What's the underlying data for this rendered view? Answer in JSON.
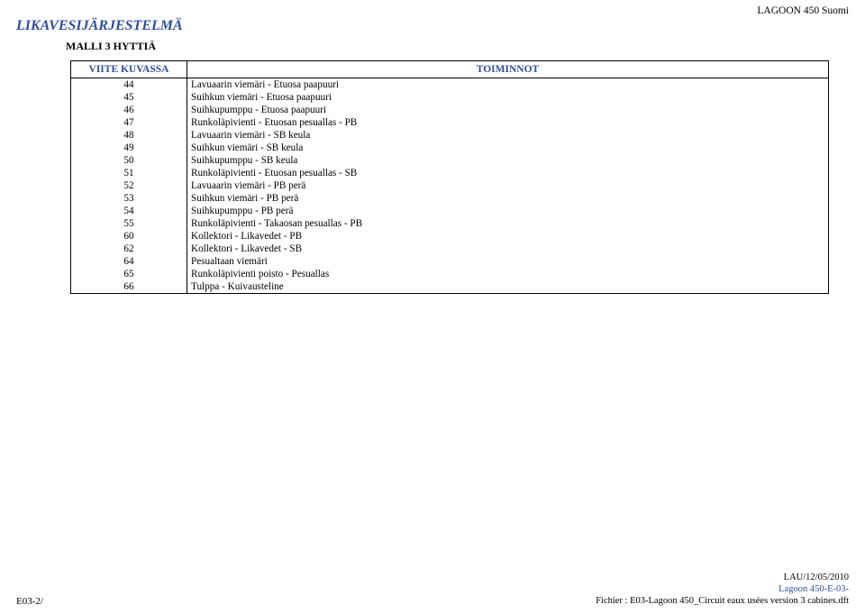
{
  "header": {
    "top_right": "LAGOON 450 Suomi",
    "title": "LIKAVESIJÄRJESTELMÄ",
    "subtitle": "MALLI 3 HYTTIÄ"
  },
  "table": {
    "col_ref": "VIITE KUVASSA",
    "col_func": "TOIMINNOT",
    "rows": [
      {
        "ref": "44",
        "func": "Lavuaarin viemäri - Etuosa paapuuri"
      },
      {
        "ref": "45",
        "func": "Suihkun viemäri - Etuosa paapuuri"
      },
      {
        "ref": "46",
        "func": "Suihkupumppu - Etuosa paapuuri"
      },
      {
        "ref": "47",
        "func": "Runkoläpivienti - Etuosan pesuallas - PB"
      },
      {
        "ref": "48",
        "func": "Lavuaarin viemäri - SB keula"
      },
      {
        "ref": "49",
        "func": "Suihkun viemäri - SB keula"
      },
      {
        "ref": "50",
        "func": "Suihkupumppu - SB keula"
      },
      {
        "ref": "51",
        "func": "Runkoläpivienti - Etuosan pesuallas - SB"
      },
      {
        "ref": "52",
        "func": "Lavuaarin viemäri - PB perä"
      },
      {
        "ref": "53",
        "func": "Suihkun viemäri - PB perä"
      },
      {
        "ref": "54",
        "func": "Suihkupumppu - PB perä"
      },
      {
        "ref": "55",
        "func": "Runkoläpivienti - Takaosan pesuallas - PB"
      },
      {
        "ref": "60",
        "func": "Kollektori - Likavedet - PB"
      },
      {
        "ref": "62",
        "func": "Kollektori - Likavedet - SB"
      },
      {
        "ref": "64",
        "func": "Pesualtaan viemäri"
      },
      {
        "ref": "65",
        "func": "Runkoläpivienti poisto - Pesuallas"
      },
      {
        "ref": "66",
        "func": "Tulppa - Kuivausteline"
      }
    ]
  },
  "footer": {
    "left": "E03-2/",
    "right_line1": "LAU/12/05/2010",
    "right_line2": "Lagoon 450-E-03-",
    "right_line3": "Fichier : E03-Lagoon 450_Circuit eaux usées version 3 cabines.dft"
  }
}
